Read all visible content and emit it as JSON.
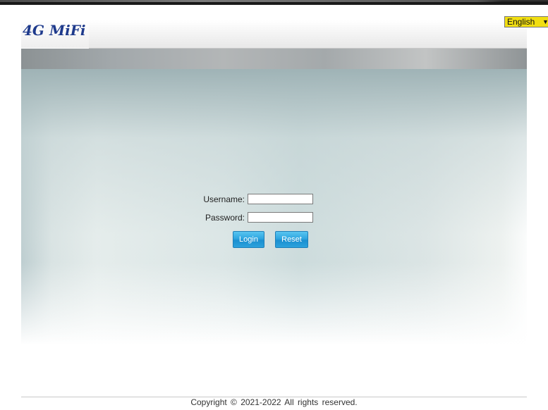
{
  "header": {
    "logo_text": "4G MiFi",
    "language": {
      "selected": "English"
    }
  },
  "login": {
    "username_label": "Username:",
    "password_label": "Password:",
    "username_value": "",
    "password_value": "",
    "login_label": "Login",
    "reset_label": "Reset"
  },
  "footer": {
    "copyright": "Copyright © 2021-2022 All rights reserved."
  },
  "colors": {
    "logo_blue": "#1e3a8c",
    "language_select_bg": "#f1de11",
    "button_blue": "#2ea6e0"
  }
}
